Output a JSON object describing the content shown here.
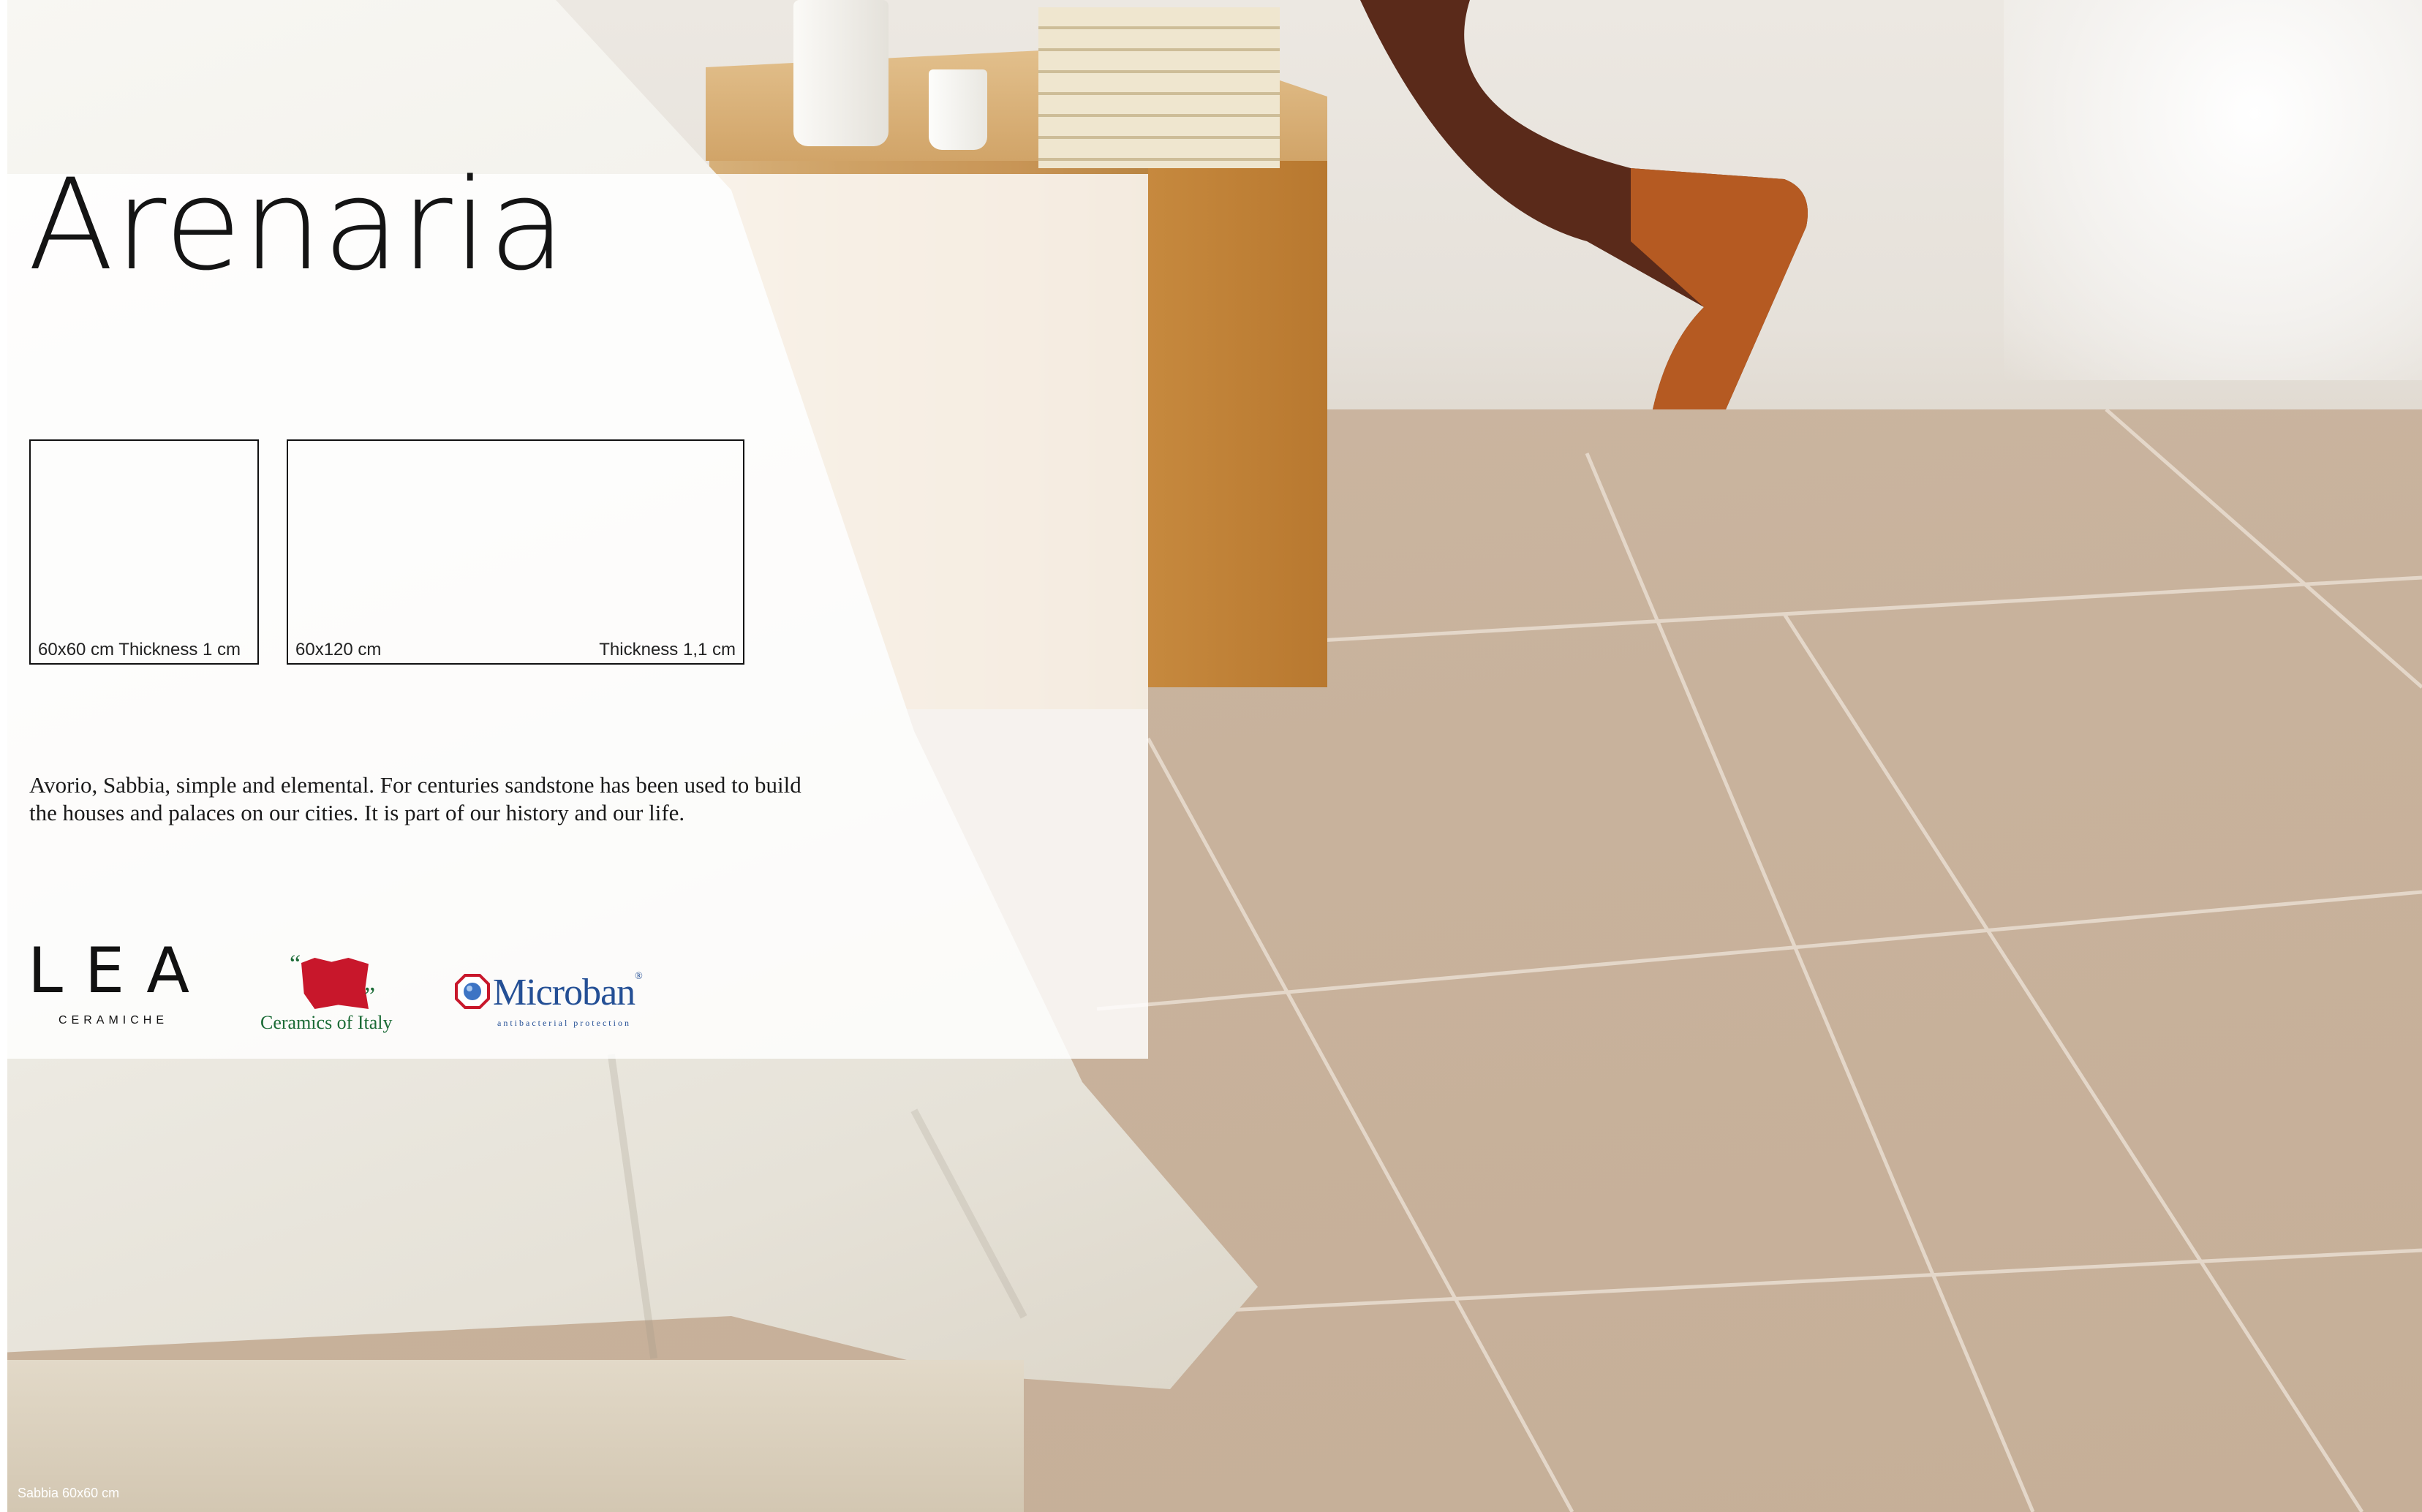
{
  "title": "Arenaria",
  "sizes": [
    {
      "label": "60x60 cm Thickness 1 cm"
    },
    {
      "size": "60x120 cm",
      "thickness": "Thickness 1,1 cm"
    }
  ],
  "description": "Avorio, Sabbia, simple and elemental. For centuries sandstone has been used to build the houses and palaces on our cities. It is part of our history and our life.",
  "logos": {
    "lea": {
      "wordmark": "LEA",
      "subtitle": "CERAMICHE"
    },
    "ceramics_of_italy": {
      "text": "Ceramics of Italy"
    },
    "microban": {
      "wordmark": "Microban",
      "tagline": "antibacterial protection"
    }
  },
  "caption": "Sabbia 60x60 cm",
  "colors": {
    "panel": "#ffffff",
    "text": "#141414",
    "ceramics_green": "#1b6b36",
    "ceramics_red": "#c8172b",
    "microban_blue": "#244f95"
  }
}
